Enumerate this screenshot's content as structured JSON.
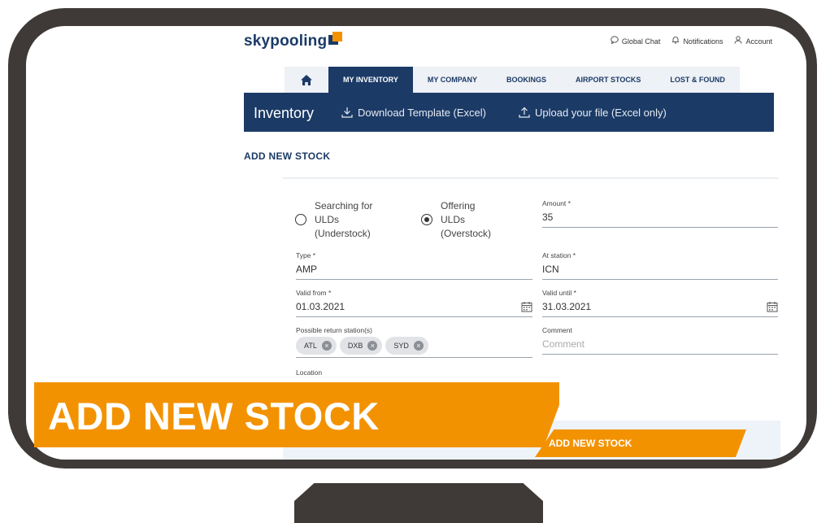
{
  "brand": {
    "name": "skypooling"
  },
  "header": {
    "links": [
      {
        "label": "Global Chat",
        "icon": "chat-icon"
      },
      {
        "label": "Notifications",
        "icon": "bell-icon"
      },
      {
        "label": "Account",
        "icon": "user-icon"
      }
    ]
  },
  "tabs": [
    {
      "label": "MY INVENTORY",
      "active": true
    },
    {
      "label": "MY COMPANY"
    },
    {
      "label": "BOOKINGS"
    },
    {
      "label": "AIRPORT STOCKS"
    },
    {
      "label": "LOST & FOUND"
    }
  ],
  "toolbar": {
    "title": "Inventory",
    "download": "Download Template (Excel)",
    "upload": "Upload your file (Excel only)"
  },
  "section_title": "ADD NEW STOCK",
  "form": {
    "radio_searching": [
      "Searching for",
      "ULDs",
      "(Understock)"
    ],
    "radio_offering": [
      "Offering",
      "ULDs",
      "(Overstock)"
    ],
    "selected": "offering",
    "amount": {
      "label": "Amount *",
      "value": "35"
    },
    "type": {
      "label": "Type *",
      "value": "AMP"
    },
    "at_station": {
      "label": "At station *",
      "value": "ICN"
    },
    "valid_from": {
      "label": "Valid from *",
      "value": "01.03.2021"
    },
    "valid_until": {
      "label": "Valid until *",
      "value": "31.03.2021"
    },
    "return_stations": {
      "label": "Possible return station(s)",
      "chips": [
        "ATL",
        "DXB",
        "SYD"
      ]
    },
    "comment": {
      "label": "Comment",
      "placeholder": "Comment"
    },
    "location": {
      "label": "Location"
    },
    "submit": "ADD NEW STOCK"
  },
  "banner": {
    "text": "ADD NEW STOCK"
  },
  "colors": {
    "navy": "#1b3a66",
    "orange": "#f39200",
    "frame": "#3f3a37"
  }
}
